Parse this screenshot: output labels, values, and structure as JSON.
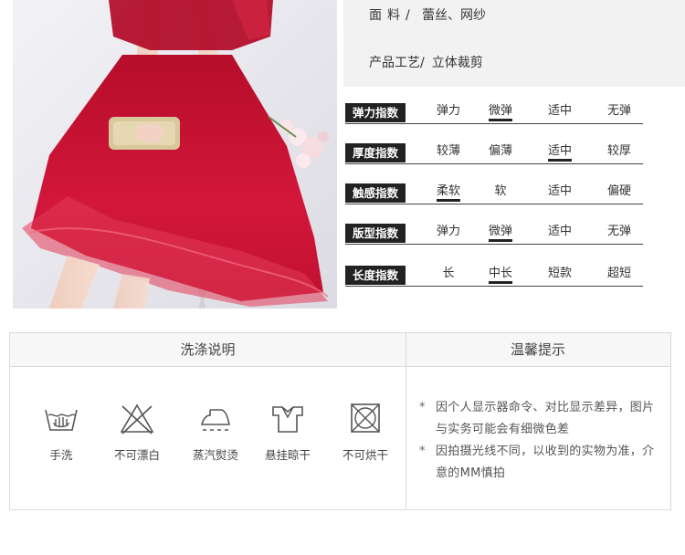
{
  "specs": {
    "material": {
      "label": "面料/",
      "value": "蕾丝、网纱"
    },
    "craft": {
      "label": "产品工艺/",
      "value": "立体裁剪"
    }
  },
  "indexes": [
    {
      "name": "弹力指数",
      "options": [
        "弹力",
        "微弹",
        "适中",
        "无弹"
      ],
      "selected": 1
    },
    {
      "name": "厚度指数",
      "options": [
        "较薄",
        "偏薄",
        "适中",
        "较厚"
      ],
      "selected": 2
    },
    {
      "name": "触感指数",
      "options": [
        "柔软",
        "软",
        "适中",
        "偏硬"
      ],
      "selected": 0
    },
    {
      "name": "版型指数",
      "options": [
        "弹力",
        "微弹",
        "适中",
        "无弹"
      ],
      "selected": 1
    },
    {
      "name": "长度指数",
      "options": [
        "长",
        "中长",
        "短款",
        "超短"
      ],
      "selected": 1
    }
  ],
  "care": {
    "wash_title": "洗涤说明",
    "notice_title": "温馨提示",
    "wash_items": [
      {
        "label": "手洗",
        "icon": "hand-wash-icon"
      },
      {
        "label": "不可漂白",
        "icon": "no-bleach-icon"
      },
      {
        "label": "蒸汽熨烫",
        "icon": "steam-iron-icon"
      },
      {
        "label": "悬挂晾干",
        "icon": "hang-dry-icon"
      },
      {
        "label": "不可烘干",
        "icon": "no-tumble-dry-icon"
      }
    ],
    "notices": [
      {
        "star": "*",
        "text": "因个人显示器命令、对比显示差异，图片与实务可能会有细微色差"
      },
      {
        "star": "*",
        "text": "因拍摄光线不同，以收到的实物为准，介意的MM慎拍"
      }
    ]
  },
  "colors": {
    "dress": "#c8102e",
    "tag_bg": "#222222",
    "panel_bg": "#f2f2f2"
  }
}
